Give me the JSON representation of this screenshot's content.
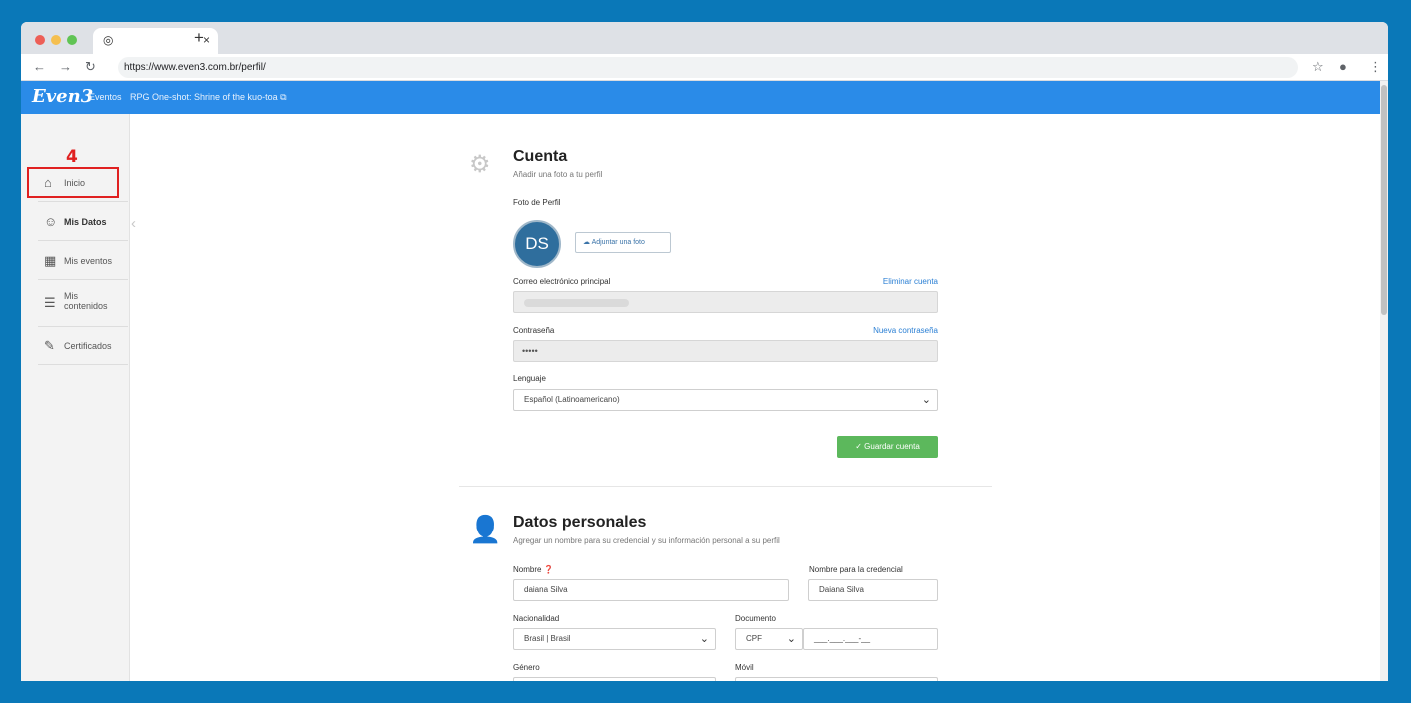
{
  "browser": {
    "url": "https://www.even3.com.br/perfil/",
    "new_tab_symbol": "+",
    "tab_close_symbol": "×"
  },
  "site_header": {
    "logo": "Even3",
    "nav_events": "Eventos",
    "event_title": "RPG One-shot: Shrine of the kuo-toa",
    "external_symbol": "⧉"
  },
  "annotation": {
    "step_number": "4"
  },
  "sidebar": {
    "items": [
      {
        "label": "Inicio",
        "icon": "home-icon"
      },
      {
        "label": "Mis Datos",
        "icon": "user-icon"
      },
      {
        "label": "Mis eventos",
        "icon": "calendar-icon"
      },
      {
        "label": "Mis contenidos",
        "icon": "content-icon"
      },
      {
        "label": "Certificados",
        "icon": "certificate-icon"
      }
    ]
  },
  "account": {
    "title": "Cuenta",
    "subtitle": "Añadir una foto a tu perfil",
    "photo_label": "Foto de Perfil",
    "avatar_initials": "DS",
    "attach_label": "Adjuntar una foto",
    "email_label": "Correo electrónico principal",
    "delete_account": "Eliminar cuenta",
    "password_label": "Contraseña",
    "new_password": "Nueva contraseña",
    "password_value": "•••••",
    "language_label": "Lenguaje",
    "language_value": "Español (Latinoamericano)",
    "save_label": "Guardar cuenta"
  },
  "personal": {
    "title": "Datos personales",
    "subtitle": "Agregar un nombre para su credencial y su información personal a su perfil",
    "name_label": "Nombre",
    "name_value": "daiana Silva",
    "credential_label": "Nombre para la credencial",
    "credential_value": "Daiana Silva",
    "nationality_label": "Nacionalidad",
    "nationality_value": "Brasil | Brasil",
    "document_label": "Documento",
    "document_type": "CPF",
    "document_placeholder": "___.___.___-__",
    "gender_label": "Género",
    "mobile_label": "Móvil"
  },
  "colors": {
    "accent": "#2a8be8",
    "save_green": "#5cb85c",
    "annotation_red": "#e02020",
    "desktop_blue": "#0a78b8"
  }
}
